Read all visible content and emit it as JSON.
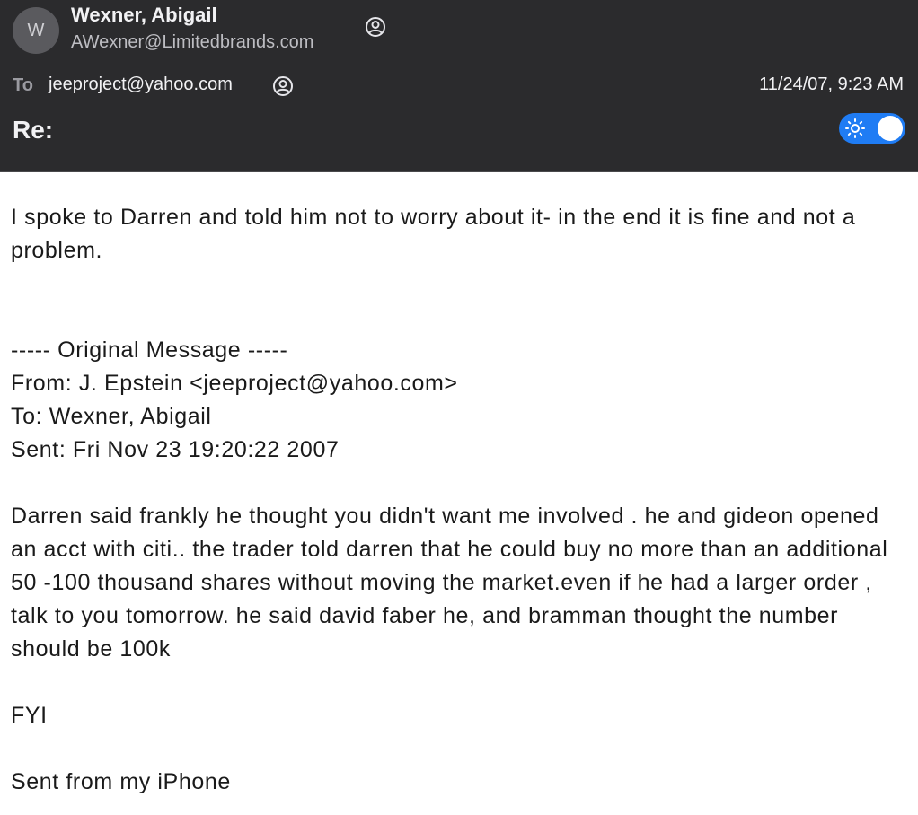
{
  "header": {
    "avatar_initial": "W",
    "sender_name": "Wexner, Abigail",
    "sender_email": "AWexner@Limitedbrands.com",
    "to_label": "To",
    "to_value": "jeeproject@yahoo.com",
    "date": "11/24/07, 9:23 AM",
    "subject": "Re:",
    "toggle_on": true,
    "accent_color": "#1f7cf4"
  },
  "body": {
    "reply": "I spoke to Darren and told him not to worry about it- in the end it is fine and not a problem.",
    "original_header": "----- Original Message -----",
    "from_line": "From: J. Epstein <jeeproject@yahoo.com>",
    "to_line": "To: Wexner, Abigail",
    "sent_line": "Sent: Fri Nov 23 19:20:22 2007",
    "original_text": "Darren said frankly  he thought you didn't want me involved . he and gideon opened an acct with citi.. the trader told darren that he could buy no more than an additional 50 -100 thousand shares without moving the market.even if he had a larger order , talk to you tomorrow. he said david faber he, and bramman thought the number should be 100k",
    "fyi": "FYI",
    "signature": "Sent from my iPhone"
  }
}
